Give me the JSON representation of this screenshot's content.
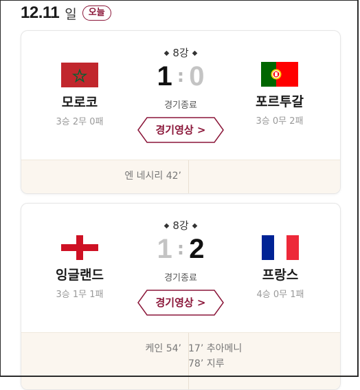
{
  "date": {
    "value": "12.11",
    "weekday": "일",
    "today_badge": "오늘"
  },
  "theme": {
    "accent": "#8a1538",
    "goal_bg": "#fbf6ef"
  },
  "matches": [
    {
      "stage": "8강",
      "home": {
        "name": "모로코",
        "record": "3승 2무 0패",
        "flag": "morocco-flag",
        "score": "1"
      },
      "away": {
        "name": "포르투갈",
        "record": "3승 0무 2패",
        "flag": "portugal-flag",
        "score": "0"
      },
      "colon": ":",
      "status": "경기종료",
      "highlight_label": "경기영상",
      "home_goals": [
        "엔 네시리 42’"
      ],
      "away_goals": []
    },
    {
      "stage": "8강",
      "home": {
        "name": "잉글랜드",
        "record": "3승 1무 1패",
        "flag": "england-flag",
        "score": "1"
      },
      "away": {
        "name": "프랑스",
        "record": "4승 0무 1패",
        "flag": "france-flag",
        "score": "2"
      },
      "colon": ":",
      "status": "경기종료",
      "highlight_label": "경기영상",
      "home_goals": [
        "케인 54’"
      ],
      "away_goals": [
        "17’ 추아메니",
        "78’ 지루"
      ]
    }
  ]
}
